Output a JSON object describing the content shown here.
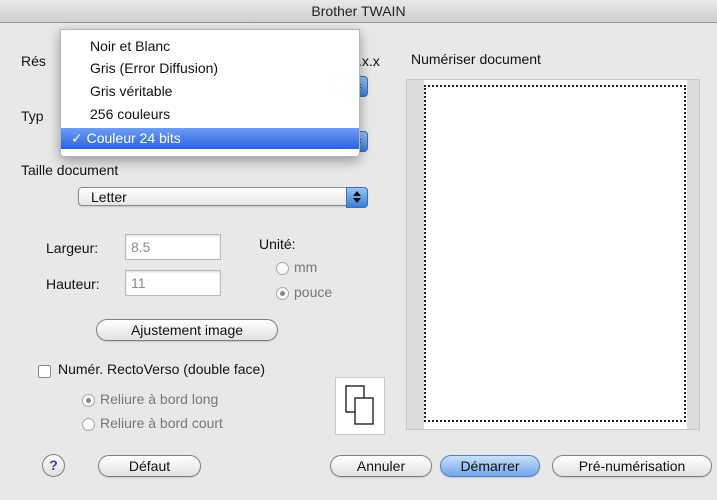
{
  "window": {
    "title": "Brother TWAIN"
  },
  "labels": {
    "resolution_partial": "Rés",
    "resolution_value_partial": ".x.x",
    "type_partial": "Typ",
    "doc_size": "Taille document",
    "width": "Largeur:",
    "height": "Hauteur:",
    "unit": "Unité:",
    "scan_doc": "Numériser document"
  },
  "menu": {
    "items": [
      "Noir et Blanc",
      "Gris (Error Diffusion)",
      "Gris véritable",
      "256 couleurs",
      "✓ Couleur 24 bits"
    ],
    "selected_index": 4
  },
  "doc_size_select": {
    "value": "Letter"
  },
  "fields": {
    "width_value": "8.5",
    "height_value": "11"
  },
  "unit_options": {
    "mm": "mm",
    "inch": "pouce",
    "selected": "pouce"
  },
  "buttons": {
    "adjust_image": "Ajustement image",
    "help": "?",
    "default": "Défaut",
    "cancel": "Annuler",
    "start": "Démarrer",
    "prescan": "Pré-numérisation"
  },
  "duplex": {
    "label": "Numér. RectoVerso (double face)",
    "checked": false,
    "long_edge": "Reliure à bord long",
    "short_edge": "Reliure à bord court",
    "selected": "long_edge"
  },
  "colors": {
    "accent": "#2a62e4",
    "window_bg": "#e8e8e8"
  }
}
